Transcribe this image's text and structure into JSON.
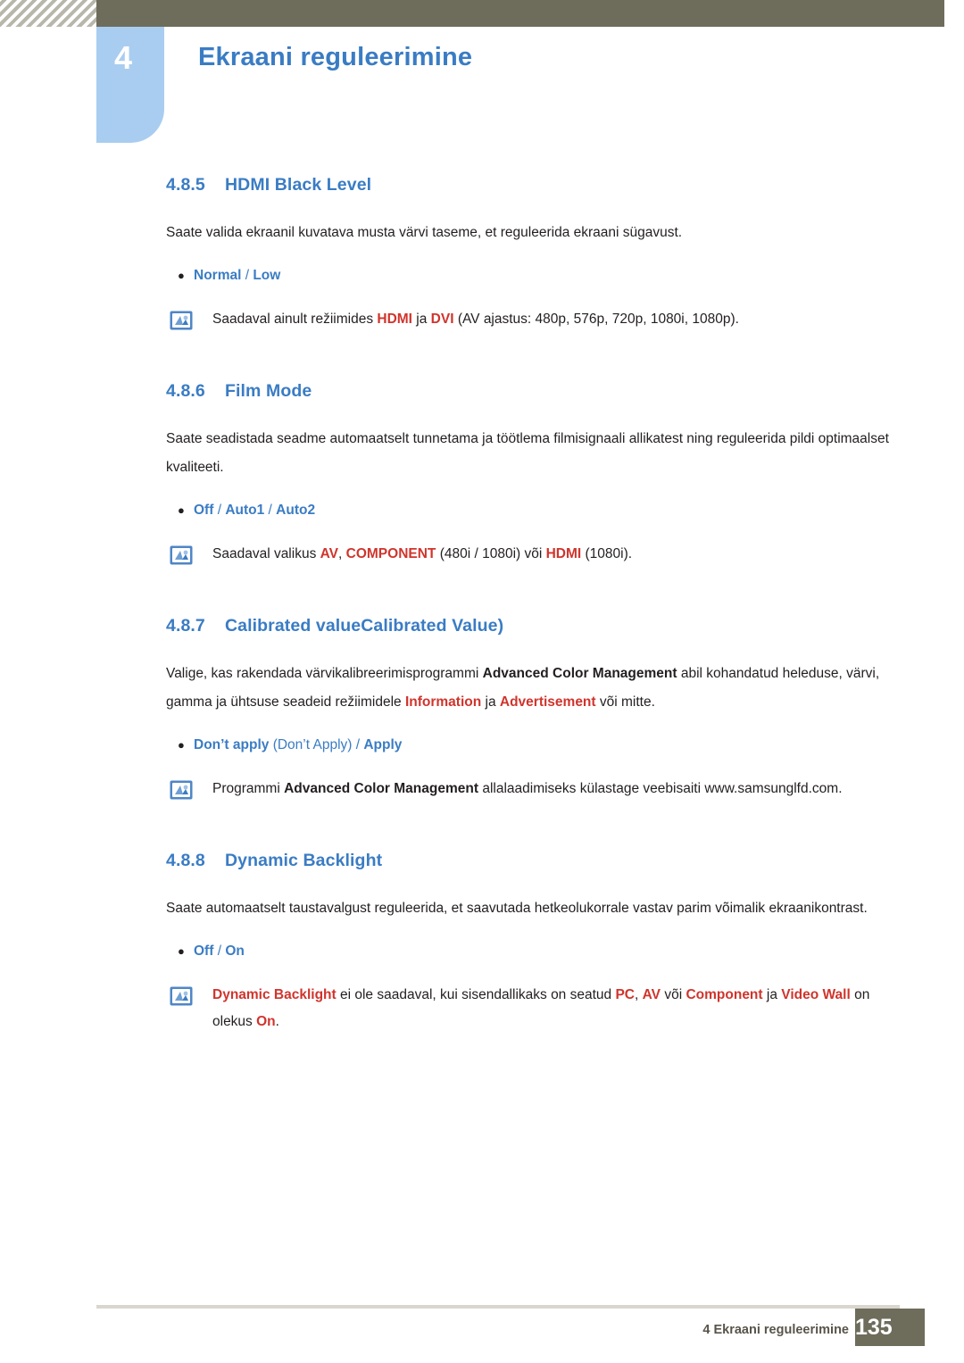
{
  "header": {
    "chapter_number": "4",
    "chapter_title": "Ekraani reguleerimine"
  },
  "sections": [
    {
      "number": "4.8.5",
      "title": "HDMI Black Level",
      "body": "Saate valida ekraanil kuvatava musta värvi taseme, et reguleerida ekraani sügavust.",
      "bullet": "Normal / Low",
      "note": "Saadaval ainult režiimides HDMI ja DVI (AV ajastus: 480p, 576p, 720p, 1080i, 1080p)."
    },
    {
      "number": "4.8.6",
      "title": "Film Mode",
      "body": "Saate seadistada seadme automaatselt tunnetama ja töötlema filmisignaali allikatest ning reguleerida pildi optimaalset kvaliteeti.",
      "bullet": "Off / Auto1 / Auto2",
      "note": "Saadaval valikus AV, COMPONENT (480i / 1080i) või HDMI (1080i)."
    },
    {
      "number": "4.8.7",
      "title": "Calibrated valueCalibrated Value)",
      "title_display": "Calibrated valueCalibrated Value)",
      "body_line1": "Valige, kas rakendada värvikalibreerimisprogrammi Advanced Color Management abil kohandatud",
      "body_line2": "heleduse, värvi, gamma ja ühtsuse seadeid režiimidele Information ja Advertisement või mitte.",
      "bullet": "Don’t apply (Don’t Apply) / Apply",
      "note": "Programmi Advanced Color Management allalaadimiseks külastage veebisaiti www.samsunglfd.com."
    },
    {
      "number": "4.8.8",
      "title": "Dynamic Backlight",
      "body": "Saate automaatselt taustavalgust reguleerida, et saavutada hetkeolukorrale vastav parim võimalik ekraanikontrast.",
      "bullet": "Off / On",
      "note": "Dynamic Backlight ei ole saadaval, kui sisendallikaks on seatud PC, AV või Component ja Video Wall on olekus On."
    }
  ],
  "text_fragments": {
    "s5_note_a": "Saadaval ainult režiimides ",
    "s5_note_hdmi": "HDMI",
    "s5_note_b": " ja ",
    "s5_note_dvi": "DVI",
    "s5_note_c": " (AV ajastus: 480p, 576p, 720p, 1080i, 1080p).",
    "s6_note_a": "Saadaval valikus ",
    "s6_note_av": "AV",
    "s6_note_comma": ", ",
    "s6_note_component": "COMPONENT",
    "s6_note_b": " (480i / 1080i) või ",
    "s6_note_hdmi": "HDMI",
    "s6_note_c": " (1080i).",
    "s7_body_a": "Valige, kas rakendada värvikalibreerimisprogrammi ",
    "s7_body_acm": "Advanced Color Management",
    "s7_body_b": " abil kohandatud heleduse, värvi, gamma ja ühtsuse seadeid režiimidele ",
    "s7_body_info": "Information",
    "s7_body_c": " ja ",
    "s7_body_adv": "Advertisement",
    "s7_body_d": " või mitte.",
    "s7_note_a": "Programmi ",
    "s7_note_acm": "Advanced Color Management",
    "s7_note_b": " allalaadimiseks külastage veebisaiti www.samsunglfd.com.",
    "s8_note_db": "Dynamic Backlight",
    "s8_note_a": " ei ole saadaval, kui sisendallikaks on seatud ",
    "s8_note_pc": "PC",
    "s8_note_comma": ", ",
    "s8_note_av": "AV",
    "s8_note_b": " või ",
    "s8_note_component": "Component",
    "s8_note_c": " ja ",
    "s8_note_vw": "Video Wall",
    "s8_note_d": " on olekus ",
    "s8_note_on": "On",
    "s8_note_e": ".",
    "bullet5_a": "Normal",
    "bullet5_sep": " / ",
    "bullet5_b": "Low",
    "bullet6_a": "Off",
    "bullet6_sep1": " / ",
    "bullet6_b": "Auto1",
    "bullet6_sep2": " / ",
    "bullet6_c": "Auto2",
    "bullet7_a": "Don’t apply",
    "bullet7_paren1": " (Don’t Apply)",
    "bullet7_sep": " / ",
    "bullet7_b": "Apply",
    "bullet8_a": "Off",
    "bullet8_sep": " / ",
    "bullet8_b": "On",
    "bullet_marker": "●"
  },
  "footer": {
    "text": "4 Ekraani reguleerimine",
    "page": "135"
  },
  "colors": {
    "accent_blue": "#3a7cc4",
    "red": "#d0342c",
    "header_olive": "#6e6c5b",
    "tab_blue": "#a9cdf0"
  }
}
